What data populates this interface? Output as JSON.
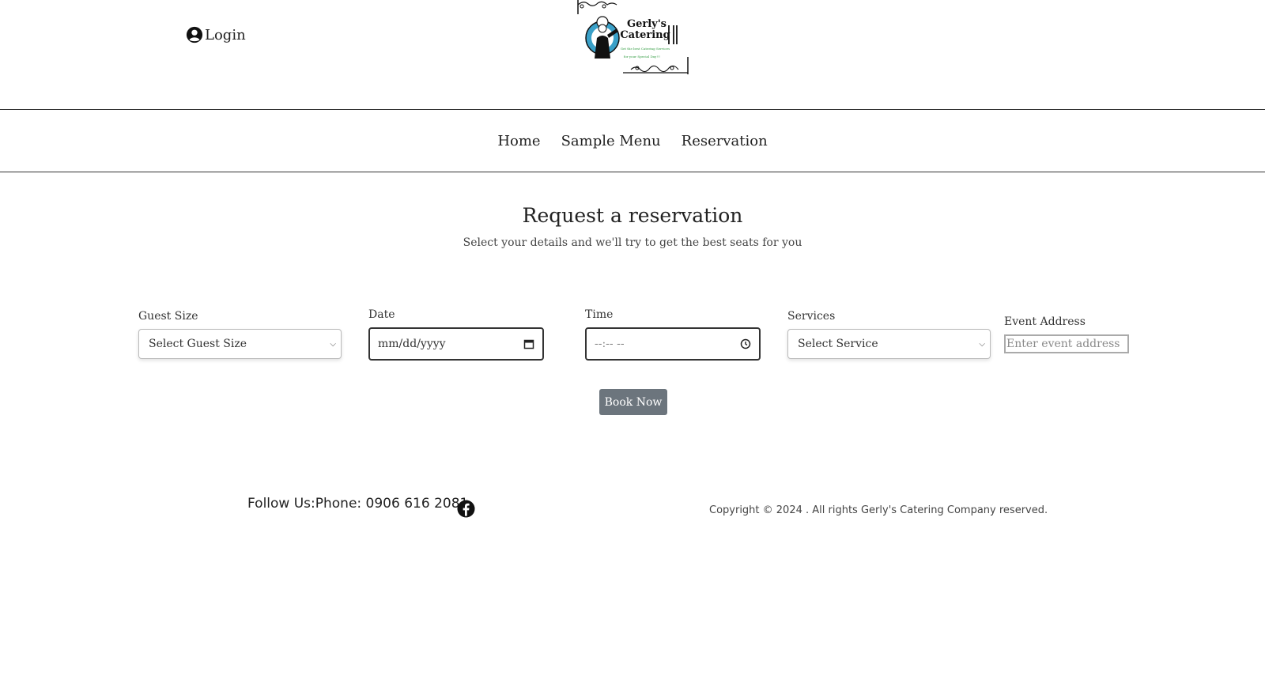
{
  "header": {
    "login_label": "Login",
    "logo": {
      "title_line1": "Gerly's",
      "title_line2": "Catering",
      "tagline_line1": "Get the best Catering Services",
      "tagline_line2": "for your Special Day!!!"
    }
  },
  "nav": {
    "items": [
      {
        "label": "Home"
      },
      {
        "label": "Sample Menu"
      },
      {
        "label": "Reservation"
      }
    ]
  },
  "main": {
    "title": "Request a reservation",
    "subtitle": "Select your details and we'll try to get the best seats for you"
  },
  "form": {
    "guest_size": {
      "label": "Guest Size",
      "value": "Select Guest Size"
    },
    "date": {
      "label": "Date",
      "value": "mm/dd/yyyy"
    },
    "time": {
      "label": "Time",
      "value": "--:-- --"
    },
    "services": {
      "label": "Services",
      "value": "Select Service"
    },
    "event_address": {
      "label": "Event Address",
      "placeholder": "Enter event address"
    },
    "submit_label": "Book Now"
  },
  "footer": {
    "contact": "Follow Us:Phone: 0906 616 2081",
    "copyright": "Copyright © 2024 . All rights Gerly's Catering Company reserved."
  },
  "colors": {
    "button_bg": "#6c757d",
    "logo_circle": "#3aa0c8",
    "logo_tagline": "#2e9a3e"
  }
}
